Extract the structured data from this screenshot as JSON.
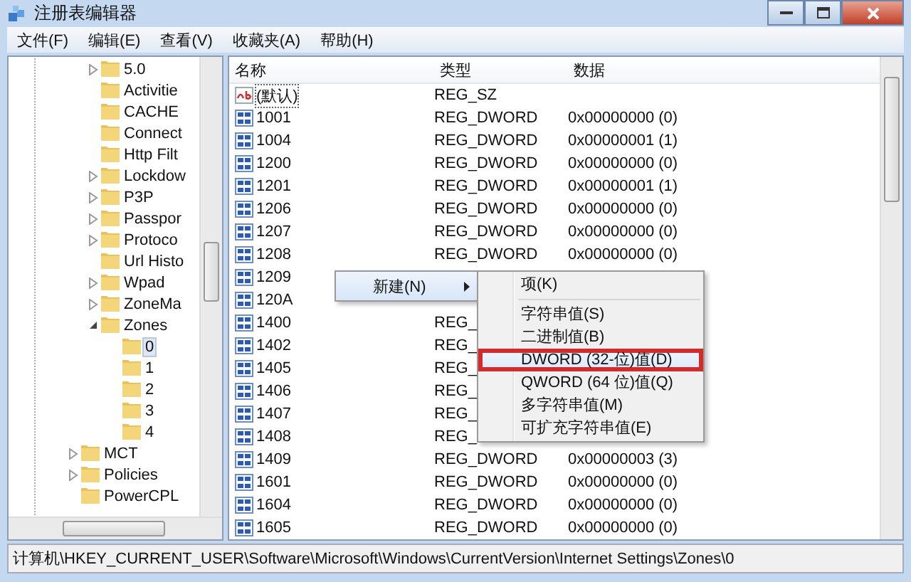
{
  "window": {
    "title": "注册表编辑器"
  },
  "menu_bar": [
    "文件(F)",
    "编辑(E)",
    "查看(V)",
    "收藏夹(A)",
    "帮助(H)"
  ],
  "tree": {
    "inner_items": [
      {
        "label": "5.0",
        "expanded": false,
        "selected": false
      },
      {
        "label": "Activitie",
        "selected": false
      },
      {
        "label": "CACHE",
        "selected": false
      },
      {
        "label": "Connect",
        "selected": false
      },
      {
        "label": "Http Filt",
        "selected": false
      },
      {
        "label": "Lockdow",
        "expanded": false,
        "selected": false
      },
      {
        "label": "P3P",
        "expanded": false,
        "selected": false
      },
      {
        "label": "Passpor",
        "expanded": false,
        "selected": false
      },
      {
        "label": "Protoco",
        "expanded": false,
        "selected": false
      },
      {
        "label": "Url Histo",
        "selected": false
      },
      {
        "label": "Wpad",
        "expanded": false,
        "selected": false
      },
      {
        "label": "ZoneMa",
        "expanded": false,
        "selected": false
      },
      {
        "label": "Zones",
        "expanded": true,
        "selected": false,
        "children": [
          {
            "label": "0",
            "selected": true
          },
          {
            "label": "1",
            "selected": false
          },
          {
            "label": "2",
            "selected": false
          },
          {
            "label": "3",
            "selected": false
          },
          {
            "label": "4",
            "selected": false
          }
        ]
      }
    ],
    "outer_items": [
      {
        "label": "MCT",
        "expanded": false,
        "selected": false
      },
      {
        "label": "Policies",
        "expanded": false,
        "selected": false
      },
      {
        "label": "PowerCPL",
        "selected": false
      }
    ]
  },
  "table": {
    "columns": [
      "名称",
      "类型",
      "数据"
    ],
    "rows": [
      {
        "kind": "string",
        "name": "(默认)",
        "type": "REG_SZ",
        "data": "",
        "focused": true
      },
      {
        "kind": "dword",
        "name": "1001",
        "type": "REG_DWORD",
        "data": "0x00000000 (0)",
        "focused": false
      },
      {
        "kind": "dword",
        "name": "1004",
        "type": "REG_DWORD",
        "data": "0x00000001 (1)",
        "focused": false
      },
      {
        "kind": "dword",
        "name": "1200",
        "type": "REG_DWORD",
        "data": "0x00000000 (0)",
        "focused": false
      },
      {
        "kind": "dword",
        "name": "1201",
        "type": "REG_DWORD",
        "data": "0x00000001 (1)",
        "focused": false
      },
      {
        "kind": "dword",
        "name": "1206",
        "type": "REG_DWORD",
        "data": "0x00000000 (0)",
        "focused": false
      },
      {
        "kind": "dword",
        "name": "1207",
        "type": "REG_DWORD",
        "data": "0x00000000 (0)",
        "focused": false
      },
      {
        "kind": "dword",
        "name": "1208",
        "type": "REG_DWORD",
        "data": "0x00000000 (0)",
        "focused": false
      },
      {
        "kind": "dword",
        "name": "1209",
        "type": "",
        "data": "",
        "focused": false
      },
      {
        "kind": "dword",
        "name": "120A",
        "type": "",
        "data": "",
        "focused": false
      },
      {
        "kind": "dword",
        "name": "1400",
        "type": "REG_",
        "data": "",
        "focused": false
      },
      {
        "kind": "dword",
        "name": "1402",
        "type": "REG_",
        "data": "",
        "focused": false
      },
      {
        "kind": "dword",
        "name": "1405",
        "type": "REG_",
        "data": "",
        "focused": false
      },
      {
        "kind": "dword",
        "name": "1406",
        "type": "REG_",
        "data": "",
        "focused": false
      },
      {
        "kind": "dword",
        "name": "1407",
        "type": "REG_",
        "data": "",
        "focused": false
      },
      {
        "kind": "dword",
        "name": "1408",
        "type": "REG_",
        "data": "",
        "focused": false
      },
      {
        "kind": "dword",
        "name": "1409",
        "type": "REG_DWORD",
        "data": "0x00000003 (3)",
        "focused": false
      },
      {
        "kind": "dword",
        "name": "1601",
        "type": "REG_DWORD",
        "data": "0x00000000 (0)",
        "focused": false
      },
      {
        "kind": "dword",
        "name": "1604",
        "type": "REG_DWORD",
        "data": "0x00000000 (0)",
        "focused": false
      },
      {
        "kind": "dword",
        "name": "1605",
        "type": "REG_DWORD",
        "data": "0x00000000 (0)",
        "focused": false
      }
    ]
  },
  "context_menu": {
    "item": "新建(N)",
    "submenu": [
      {
        "label": "项(K)",
        "selected": false
      },
      {
        "label": "字符串值(S)",
        "selected": false
      },
      {
        "label": "二进制值(B)",
        "selected": false
      },
      {
        "label": "DWORD (32-位)值(D)",
        "selected": true
      },
      {
        "label": "QWORD (64 位)值(Q)",
        "selected": false
      },
      {
        "label": "多字符串值(M)",
        "selected": false
      },
      {
        "label": "可扩充字符串值(E)",
        "selected": false
      }
    ]
  },
  "status_bar": "计算机\\HKEY_CURRENT_USER\\Software\\Microsoft\\Windows\\CurrentVersion\\Internet Settings\\Zones\\0"
}
